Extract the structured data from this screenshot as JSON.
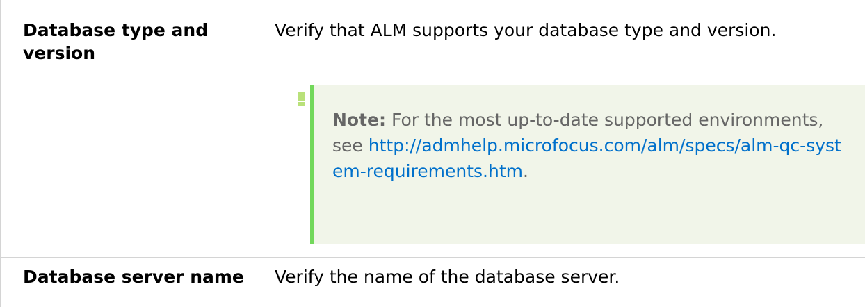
{
  "rows": [
    {
      "term": "Database type and version",
      "definition": "Verify that ALM supports your database type and version.",
      "note": {
        "label": "Note:",
        "text": "For the most up-to-date supported environments, see",
        "link": "http://admhelp.microfocus.com/alm/specs/alm-qc-system-requirements.htm",
        "after_link": "."
      }
    },
    {
      "term": "Database server name",
      "definition": "Verify the name of the database server."
    }
  ],
  "colors": {
    "note_background": "#f1f5e9",
    "note_bar": "#72d85b",
    "link": "#0070cb",
    "note_text": "#666666",
    "border": "#d4d4d4"
  },
  "icons": {
    "note_marker": "exclamation-icon"
  }
}
